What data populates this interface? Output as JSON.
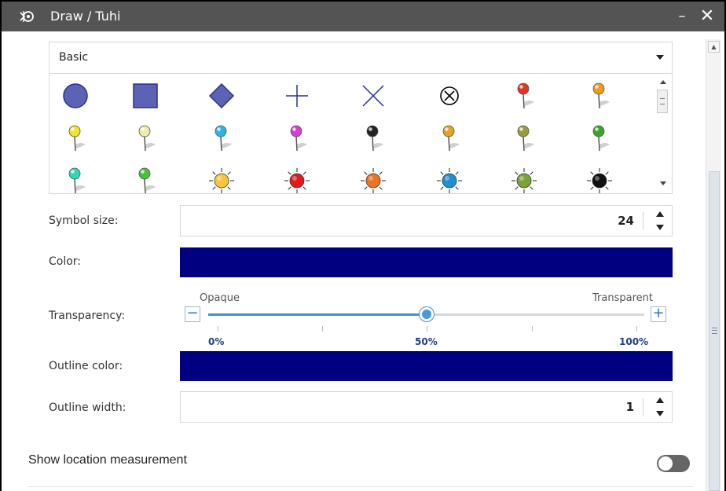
{
  "window": {
    "title": "Draw / Tuhi",
    "minimize_label": "–",
    "close_label": "✕"
  },
  "symbol_set": {
    "selected": "Basic"
  },
  "symbols": [
    {
      "icon": "circle-icon"
    },
    {
      "icon": "square-icon"
    },
    {
      "icon": "diamond-icon"
    },
    {
      "icon": "cross-icon"
    },
    {
      "icon": "x-icon"
    },
    {
      "icon": "circle-x-icon"
    },
    {
      "icon": "pushpin-red-icon",
      "color": "#e3341f"
    },
    {
      "icon": "pushpin-orange-icon",
      "color": "#f39a1e"
    },
    {
      "icon": "pushpin-yellow-icon",
      "color": "#f2e52a"
    },
    {
      "icon": "pushpin-cream-icon",
      "color": "#eeeaa8"
    },
    {
      "icon": "pushpin-cyan-icon",
      "color": "#2bb4e6"
    },
    {
      "icon": "pushpin-magenta-icon",
      "color": "#d43fcf"
    },
    {
      "icon": "pushpin-black-icon",
      "color": "#222222"
    },
    {
      "icon": "pushpin-gold-icon",
      "color": "#e6a425"
    },
    {
      "icon": "pushpin-olive-icon",
      "color": "#9a9a3a"
    },
    {
      "icon": "pushpin-green-icon",
      "color": "#3ba52a"
    },
    {
      "icon": "pushpin-teal-icon",
      "color": "#2fd9b4"
    },
    {
      "icon": "pushpin-lime-icon",
      "color": "#46c23a"
    },
    {
      "icon": "sun-yellow-icon",
      "color": "#f7c53b"
    },
    {
      "icon": "sun-red-icon",
      "color": "#e01a1a"
    },
    {
      "icon": "sun-orange-icon",
      "color": "#f0711f"
    },
    {
      "icon": "sun-blue-icon",
      "color": "#1f8fd0"
    },
    {
      "icon": "sun-green-icon",
      "color": "#7aa43a"
    },
    {
      "icon": "sun-black-icon",
      "color": "#111111"
    }
  ],
  "symbol_size": {
    "label": "Symbol size:",
    "value": "24"
  },
  "color": {
    "label": "Color:",
    "value": "#000080"
  },
  "transparency": {
    "label": "Transparency:",
    "left_caption": "Opaque",
    "right_caption": "Transparent",
    "minus_label": "−",
    "plus_label": "+",
    "value_percent": 50,
    "tick_labels": [
      "0%",
      "50%",
      "100%"
    ]
  },
  "outline_color": {
    "label": "Outline color:",
    "value": "#000080"
  },
  "outline_width": {
    "label": "Outline width:",
    "value": "1"
  },
  "show_location": {
    "label": "Show location measurement",
    "enabled": false
  }
}
